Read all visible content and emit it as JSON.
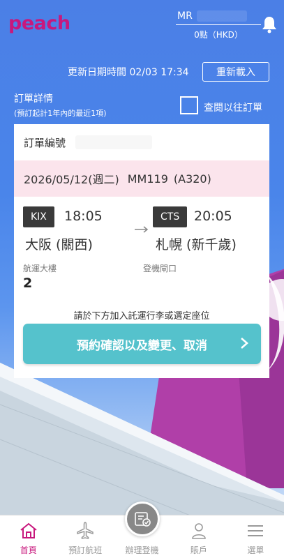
{
  "header": {
    "logo": "peach",
    "user_name": "MR",
    "points": "0點（HKD）"
  },
  "updated_text": "更新日期時間 02/03 17:34",
  "reload_label": "重新載入",
  "order": {
    "heading": "訂單詳情",
    "subheading": "(預訂起計1年內的最近1項)",
    "past_orders_label": "查閱以往訂單",
    "order_number_label": "訂單編號",
    "flight_date": "2026/05/12(週二)",
    "flight_no": "MM119",
    "aircraft": "(A320)",
    "departure": {
      "code": "KIX",
      "time": "18:05",
      "city": "大阪 (關西)"
    },
    "arrival": {
      "code": "CTS",
      "time": "20:05",
      "city": "札幌 (新千歲)"
    },
    "terminal_label": "航運大樓",
    "terminal_value": "2",
    "gate_label": "登機閘口",
    "hint": "請於下方加入託運行李或選定座位",
    "cta_label": "預約確認以及變更、取消"
  },
  "nav": {
    "items": [
      {
        "label": "首頁",
        "icon": "home-icon"
      },
      {
        "label": "預訂航班",
        "icon": "plane-icon"
      },
      {
        "label": "辦理登機",
        "icon": "checkin-icon"
      },
      {
        "label": "賬戶",
        "icon": "user-icon"
      },
      {
        "label": "選單",
        "icon": "menu-icon"
      }
    ]
  },
  "colors": {
    "brand": "#c8187d",
    "cta": "#55c2cc",
    "flight_row": "#fbe4ec",
    "sky": "#4b7fe6"
  }
}
